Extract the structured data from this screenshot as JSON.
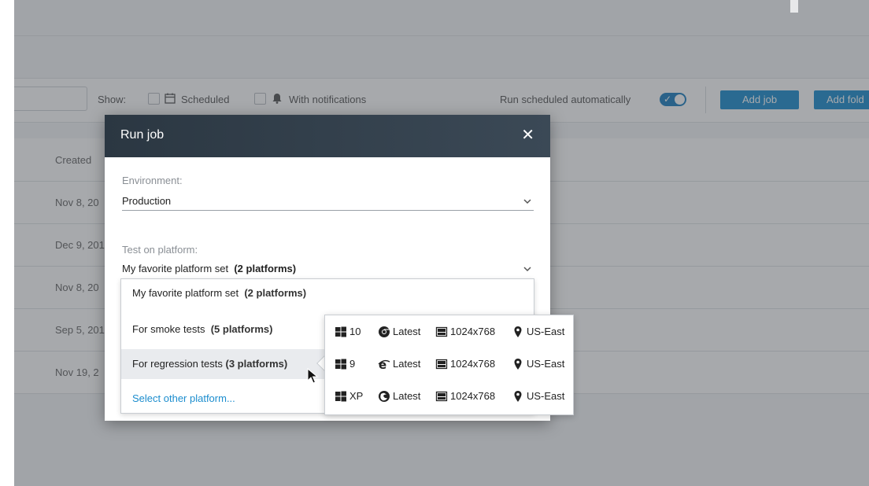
{
  "toolbar": {
    "show_label": "Show:",
    "scheduled_label": "Scheduled",
    "notifications_label": "With notifications",
    "auto_label": "Run scheduled automatically",
    "add_job_label": "Add job",
    "add_folder_label": "Add fold"
  },
  "table": {
    "created_header": "Created",
    "rows": [
      "Nov 8, 20",
      "Dec 9, 201",
      "Nov 8, 20",
      "Sep 5, 201",
      "Nov 19, 2"
    ]
  },
  "modal": {
    "title": "Run job",
    "close_symbol": "✕",
    "environment_label": "Environment:",
    "environment_value": "Production",
    "platform_label": "Test on platform:",
    "platform_value_name": "My favorite platform set",
    "platform_value_count": "(2 platforms)"
  },
  "dropdown": {
    "items": [
      {
        "name": "My favorite platform set",
        "count": "(2 platforms)"
      },
      {
        "name": "For smoke tests",
        "count": "(5 platforms)"
      },
      {
        "name": "For regression tests",
        "count": "(3 platforms)"
      }
    ],
    "other_link": "Select other platform..."
  },
  "platforms": [
    {
      "os_icon": "windows-icon",
      "os_version": "10",
      "browser_icon": "chrome-icon",
      "browser_version": "Latest",
      "resolution": "1024x768",
      "location": "US-East"
    },
    {
      "os_icon": "windows-icon",
      "os_version": "9",
      "browser_icon": "ie-icon",
      "browser_version": "Latest",
      "resolution": "1024x768",
      "location": "US-East"
    },
    {
      "os_icon": "windows-icon",
      "os_version": "XP",
      "browser_icon": "firefox-icon",
      "browser_version": "Latest",
      "resolution": "1024x768",
      "location": "US-East"
    }
  ],
  "colors": {
    "accent": "#1c8dce",
    "header_dark": "#2b3742"
  }
}
